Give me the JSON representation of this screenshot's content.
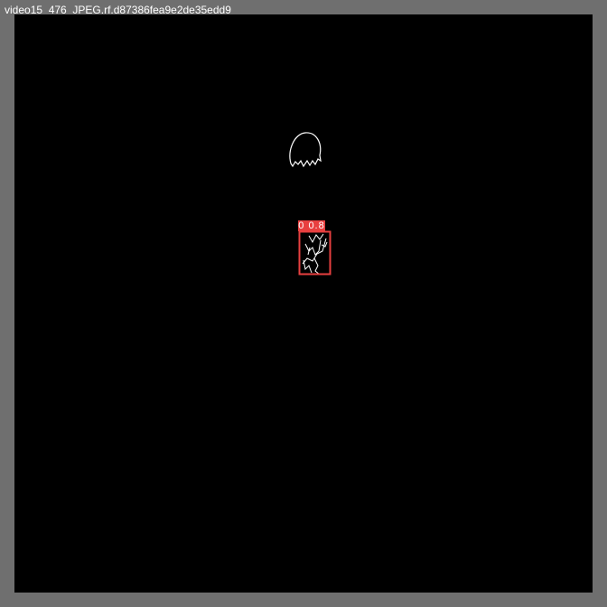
{
  "window": {
    "title": "video15_476_JPEG.rf.d87386fea9e2de35edd9"
  },
  "detections": [
    {
      "label": "0 0.8",
      "color": "#e84040"
    }
  ],
  "colors": {
    "frame": "#6f6f6f",
    "canvas": "#000000",
    "outline": "#ffffff",
    "box": "#e84040"
  }
}
